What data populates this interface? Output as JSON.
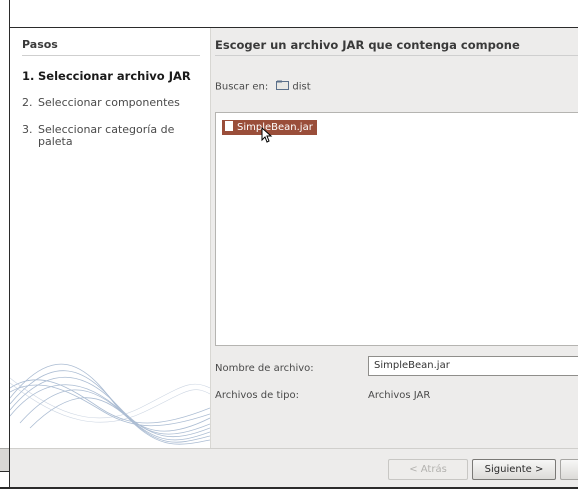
{
  "steps": {
    "title": "Pasos",
    "items": [
      {
        "num": "1.",
        "label": "Seleccionar archivo JAR"
      },
      {
        "num": "2.",
        "label": "Seleccionar componentes"
      },
      {
        "num": "3.",
        "label": "Seleccionar categoría de paleta"
      }
    ]
  },
  "main": {
    "heading": "Escoger un archivo JAR que contenga compone",
    "look_in_label": "Buscar en:",
    "look_in_value": "dist",
    "files": [
      "SimpleBean.jar"
    ],
    "file_name_label": "Nombre de archivo:",
    "file_name_value": "SimpleBean.jar",
    "file_type_label": "Archivos de tipo:",
    "file_type_value": "Archivos JAR"
  },
  "buttons": {
    "back": "< Atrás",
    "next": "Siguiente >"
  },
  "colors": {
    "selection": "#9a4e3a",
    "dialog_bg": "#edeceb"
  }
}
